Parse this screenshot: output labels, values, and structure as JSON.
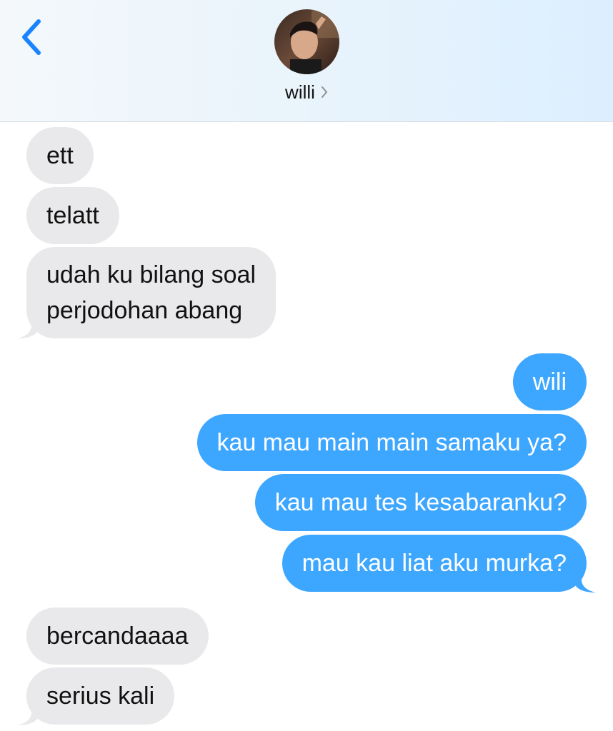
{
  "header": {
    "contact_name": "willi",
    "back_icon": "chevron-left-icon",
    "chevron_icon": "chevron-right-icon",
    "accent_color": "#1a84ff"
  },
  "messages": [
    {
      "side": "in",
      "text": "ett"
    },
    {
      "side": "in",
      "text": "telatt"
    },
    {
      "side": "in",
      "text": "udah ku bilang soal\nperjodohan abang"
    },
    {
      "side": "out",
      "text": "wili"
    },
    {
      "side": "out",
      "text": "kau mau main main samaku ya?"
    },
    {
      "side": "out",
      "text": "kau mau tes kesabaranku?"
    },
    {
      "side": "out",
      "text": "mau kau liat aku murka?"
    },
    {
      "side": "in",
      "text": "bercandaaaa"
    },
    {
      "side": "in",
      "text": "serius kali"
    }
  ],
  "colors": {
    "incoming_bubble": "#e9e9eb",
    "outgoing_bubble": "#3da6ff",
    "outgoing_text": "#ffffff"
  }
}
